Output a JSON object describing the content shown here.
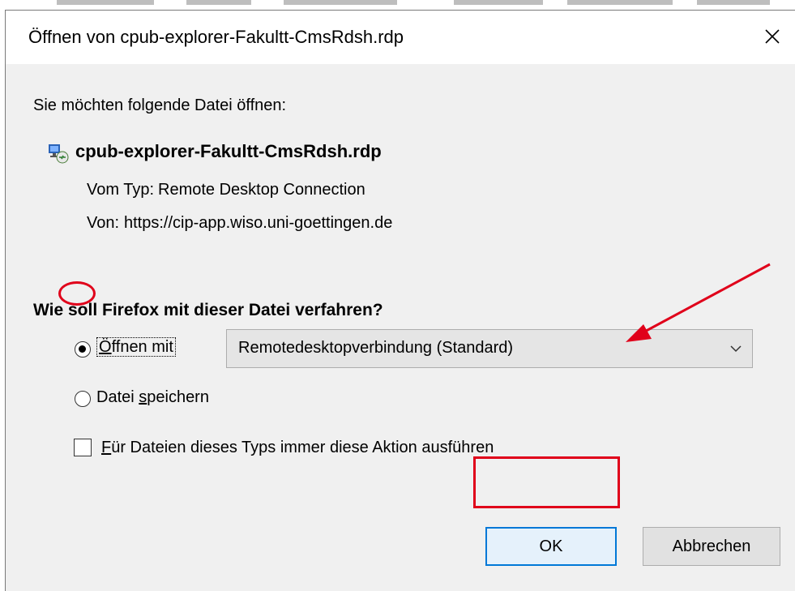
{
  "dialog": {
    "title": "Öffnen von cpub-explorer-Fakultt-CmsRdsh.rdp",
    "prompt": "Sie möchten folgende Datei öffnen:",
    "file_name": "cpub-explorer-Fakultt-CmsRdsh.rdp",
    "type_label": "Vom Typ:",
    "type_value": "Remote Desktop Connection",
    "from_label": "Von:",
    "from_value": "https://cip-app.wiso.uni-goettingen.de",
    "question": "Wie soll Firefox mit dieser Datei verfahren?",
    "open_with": {
      "label_prefix": "Ö",
      "label_rest": "ffnen mit",
      "selected": true
    },
    "application_select": {
      "value": "Remotedesktopverbindung (Standard)"
    },
    "save_file": {
      "label_prefix": "Datei ",
      "label_underlined": "s",
      "label_rest": "peichern",
      "selected": false
    },
    "always_action": {
      "label_underlined": "F",
      "label_rest": "ür Dateien dieses Typs immer diese Aktion ausführen",
      "checked": false
    },
    "ok_label": "OK",
    "cancel_label": "Abbrechen"
  },
  "icons": [
    "close-icon",
    "rdp-file-icon",
    "chevron-down-icon"
  ],
  "colors": {
    "annotation": "#e0001a",
    "focus_border": "#0078d7",
    "dialog_body": "#f0f0f0"
  }
}
